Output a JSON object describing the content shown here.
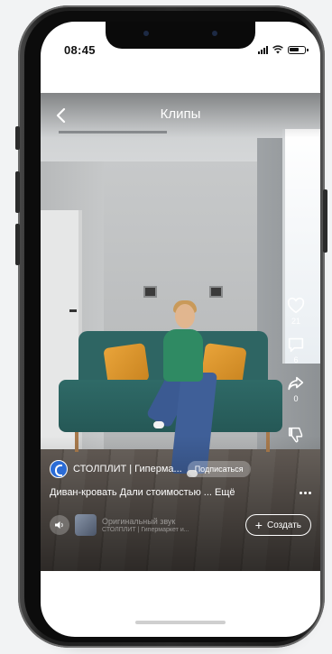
{
  "status_bar": {
    "time": "08:45"
  },
  "header": {
    "title": "Клипы"
  },
  "actions": {
    "like_count": "21",
    "comment_count": "6",
    "share_count": "0"
  },
  "clip": {
    "channel_name": "СТОЛПЛИТ | Гиперма...",
    "subscribe_label": "Подписаться",
    "description": "Диван-кровать Дали стоимостью ... Ещё"
  },
  "sound": {
    "title": "Оригинальный звук",
    "subtitle": "СТОЛПЛИТ | Гипермаркет и..."
  },
  "create": {
    "label": "Создать"
  },
  "colors": {
    "sofa": "#2e6563",
    "pillow": "#e9a43a",
    "avatar": "#2b6cd6"
  },
  "icons": [
    "back-arrow-icon",
    "heart-icon",
    "comment-icon",
    "share-icon",
    "dislike-icon",
    "more-icon",
    "sound-icon",
    "plus-icon"
  ]
}
